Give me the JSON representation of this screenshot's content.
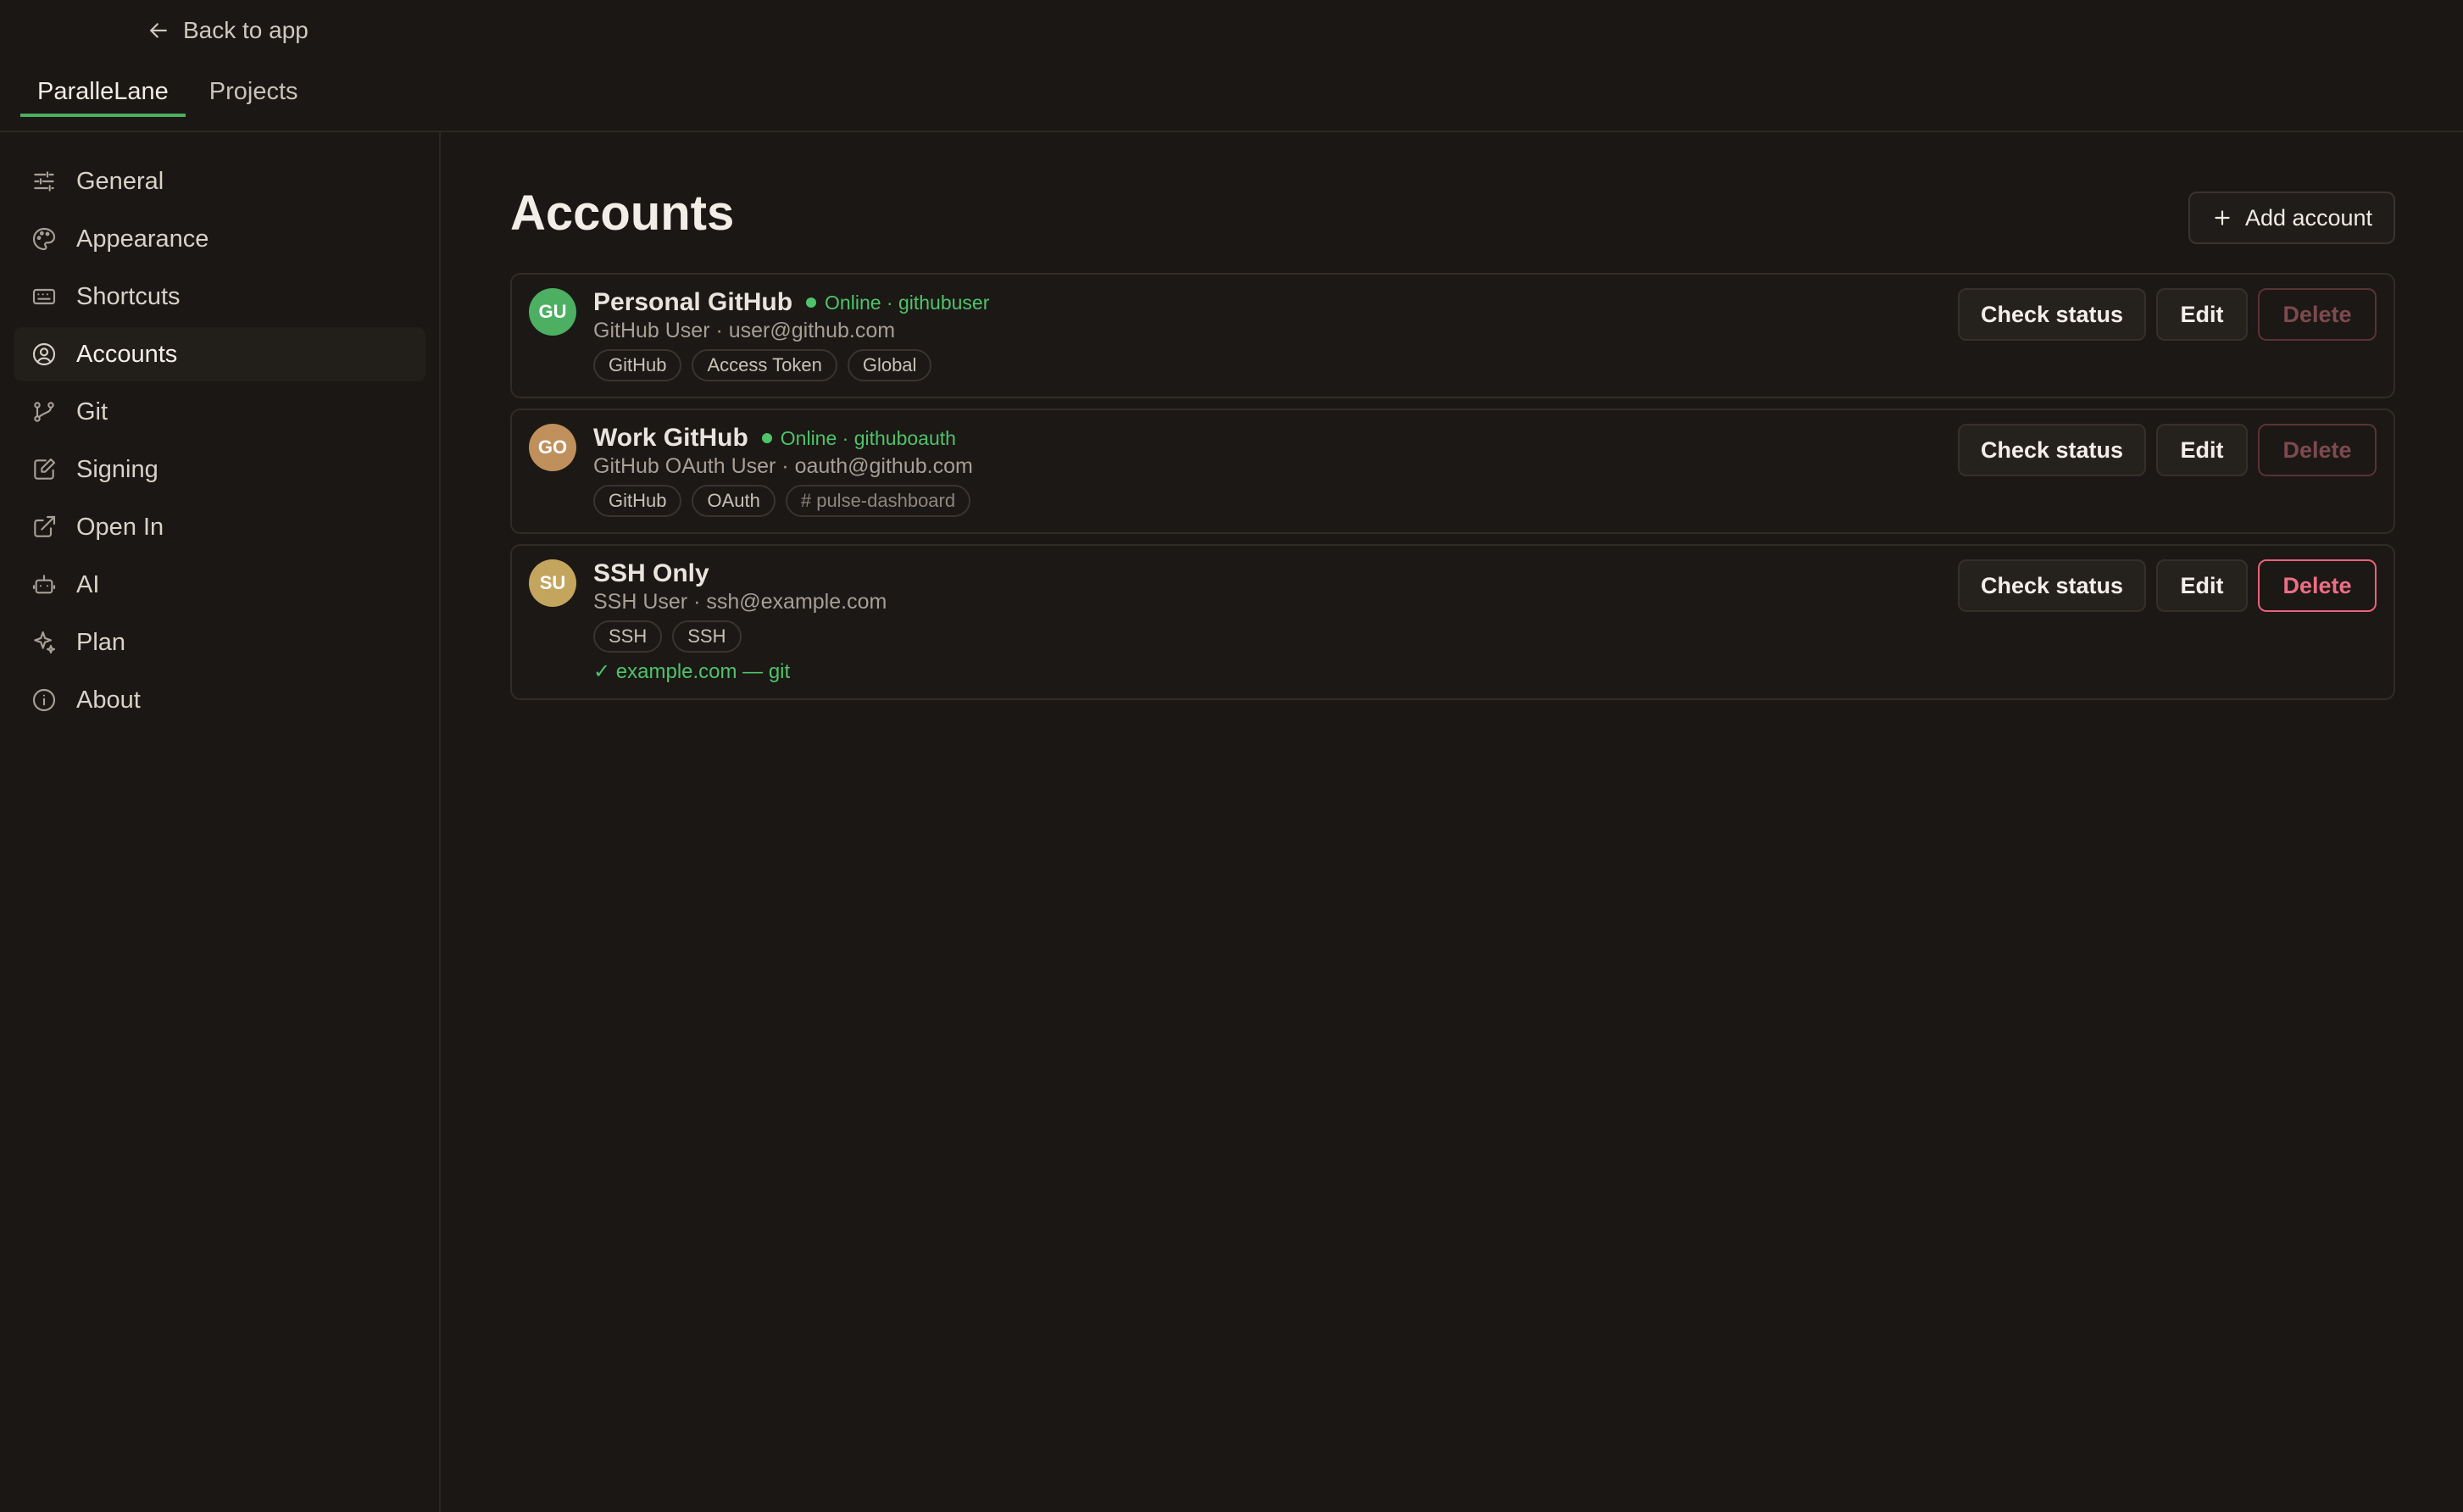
{
  "header": {
    "back_label": "Back to app",
    "tabs": [
      {
        "label": "ParalleLane",
        "active": true
      },
      {
        "label": "Projects",
        "active": false
      }
    ]
  },
  "sidebar": {
    "items": [
      {
        "label": "General",
        "icon": "sliders-icon"
      },
      {
        "label": "Appearance",
        "icon": "palette-icon"
      },
      {
        "label": "Shortcuts",
        "icon": "keyboard-icon"
      },
      {
        "label": "Accounts",
        "icon": "user-circle-icon",
        "active": true
      },
      {
        "label": "Git",
        "icon": "git-branch-icon"
      },
      {
        "label": "Signing",
        "icon": "signature-icon"
      },
      {
        "label": "Open In",
        "icon": "external-link-icon"
      },
      {
        "label": "AI",
        "icon": "robot-icon"
      },
      {
        "label": "Plan",
        "icon": "sparkles-icon"
      },
      {
        "label": "About",
        "icon": "info-icon"
      }
    ]
  },
  "main": {
    "title": "Accounts",
    "add_label": "Add account",
    "accounts": [
      {
        "initials": "GU",
        "avatar_color": "#4caf62",
        "name": "Personal GitHub",
        "status": "Online · githubuser",
        "subtitle": "GitHub User · user@github.com",
        "chips": [
          "GitHub",
          "Access Token",
          "Global"
        ],
        "check_label": "Check status",
        "edit_label": "Edit",
        "delete_label": "Delete"
      },
      {
        "initials": "GO",
        "avatar_color": "#c0905c",
        "name": "Work GitHub",
        "status": "Online · githuboauth",
        "subtitle": "GitHub OAuth User · oauth@github.com",
        "chips": [
          "GitHub",
          "OAuth",
          "# pulse-dashboard"
        ],
        "check_label": "Check status",
        "edit_label": "Edit",
        "delete_label": "Delete"
      },
      {
        "initials": "SU",
        "avatar_color": "#c4a55e",
        "name": "SSH Only",
        "subtitle": "SSH User · ssh@example.com",
        "chips": [
          "SSH",
          "SSH"
        ],
        "host_check": "✓ example.com — git",
        "check_label": "Check status",
        "edit_label": "Edit",
        "delete_label": "Delete"
      }
    ]
  },
  "colors": {
    "accent": "#4caf62",
    "online": "#4fc36a",
    "danger": "#ec6f85",
    "background": "#1a1714"
  }
}
